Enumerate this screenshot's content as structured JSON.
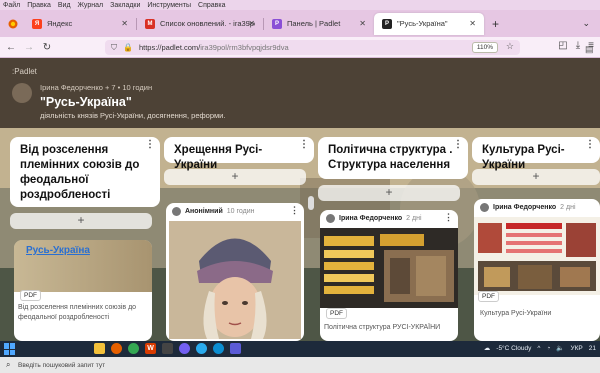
{
  "menu": [
    "Файл",
    "Правка",
    "Вид",
    "Журнал",
    "Закладки",
    "Инструменты",
    "Справка"
  ],
  "tabs": [
    {
      "label": "Яндекс",
      "icon": "yandex-icon",
      "color": "#fc3f1d",
      "glyph": "Я",
      "active": false
    },
    {
      "label": "Список оновлений. - ira39pol",
      "icon": "gmail-icon",
      "color": "#d93025",
      "glyph": "M",
      "active": false
    },
    {
      "label": "Панель | Padlet",
      "icon": "padlet-icon",
      "color": "#8a4fd6",
      "glyph": "P",
      "active": false
    },
    {
      "label": "\"Русь-Україна\"",
      "icon": "padlet-icon",
      "color": "#222222",
      "glyph": "P",
      "active": true
    }
  ],
  "nav": {
    "url_host": "https://padlet.com/",
    "url_path": "ira39pol/rm3bfvpqjdsr9dva",
    "zoom": "110%"
  },
  "board": {
    "logo": ":Padlet",
    "author_line": "Ірина Федорченко + 7 • 10 годин",
    "title": "\"Русь-Україна\"",
    "subtitle": "діяльність князів Русі-України, досягнення, реформи."
  },
  "columns": [
    {
      "title": "Від розселення племінних союзів до феодальної роздробленості"
    },
    {
      "title": "Хрещення Русі-України"
    },
    {
      "title": "Політична структура . Структура населення"
    },
    {
      "title": "Культура Русі-України"
    }
  ],
  "cards": [
    {
      "caption": "Від розселення племінних союзів до феодальної роздробленості",
      "badge": "PDF",
      "thumb_text": "Русь-Україна"
    },
    {
      "author": "Анонімний",
      "time": "10 годин"
    },
    {
      "author": "Ірина Федорченко",
      "time": "2 дні",
      "badge": "PDF",
      "caption": "Політична структура РУСІ-УКРАЇНИ"
    },
    {
      "author": "Ірина Федорченко",
      "time": "2 дні",
      "badge": "PDF",
      "caption": "Культура Русі-України"
    }
  ],
  "add_label": "+",
  "taskbar": {
    "weather": "-5°C  Cloudy",
    "lang": "УКР",
    "time": "21"
  },
  "search_hint": "Введіть пошуковий запит тут"
}
